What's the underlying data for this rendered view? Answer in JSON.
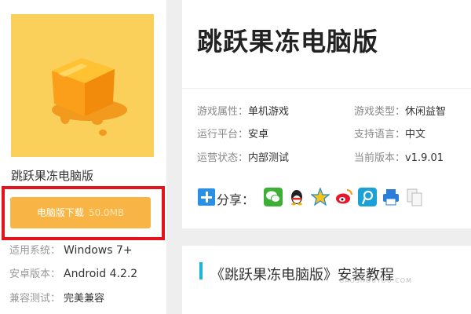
{
  "left": {
    "app_name": "跳跃果冻电脑版",
    "download": {
      "label": "电脑版下载",
      "size": "50.0MB"
    },
    "specs": [
      {
        "key": "适用系统：",
        "value": "Windows 7+"
      },
      {
        "key": "安卓版本：",
        "value": "Android 4.2.2"
      },
      {
        "key": "兼容测试：",
        "value": "完美兼容"
      }
    ]
  },
  "info": {
    "title": "跳跃果冻电脑版",
    "fields": [
      {
        "key": "游戏属性：",
        "value": "单机游戏"
      },
      {
        "key": "游戏类型：",
        "value": "休闲益智"
      },
      {
        "key": "运行平台：",
        "value": "安卓"
      },
      {
        "key": "支持语言：",
        "value": "中文"
      },
      {
        "key": "运营状态：",
        "value": "内部测试"
      },
      {
        "key": "当前版本：",
        "value": "v1.9.01"
      }
    ],
    "share_label": "分享：",
    "share_icons": [
      "wechat-icon",
      "qq-icon",
      "qzone-icon",
      "weibo-icon",
      "tencent-weibo-icon",
      "print-icon",
      "copy-icon"
    ]
  },
  "tutorial": {
    "title": "《跳跃果冻电脑版》安装教程",
    "watermark": "GAOSHOUYOU.COM"
  },
  "colors": {
    "download_button": "#f8b444",
    "highlight_border": "#e3141b",
    "icon_background": "#fbd05a",
    "accent_bar": "#1cb7d7"
  }
}
